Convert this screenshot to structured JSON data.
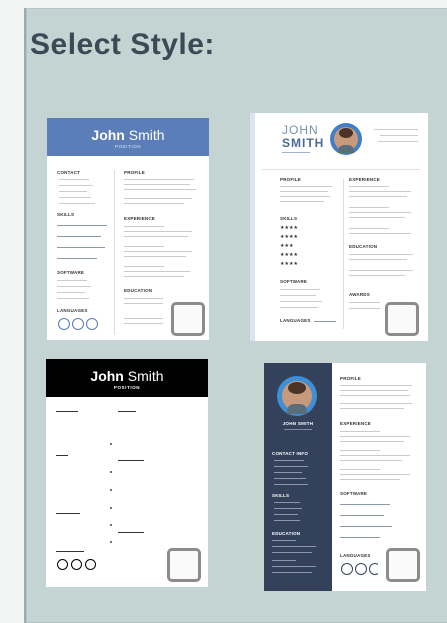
{
  "title": "Select Style:",
  "templates": [
    {
      "first": "John",
      "last": "Smith",
      "position": "POSITION",
      "sections_left": [
        "CONTACT",
        "SKILLS",
        "SOFTWARE",
        "LANGUAGES"
      ],
      "sections_right": [
        "PROFILE",
        "EXPERIENCE",
        "EDUCATION"
      ],
      "header_color": "#5b7db8"
    },
    {
      "first": "JOHN",
      "last": "SMITH",
      "sections_left": [
        "PROFILE",
        "SKILLS",
        "SOFTWARE",
        "LANGUAGES"
      ],
      "sections_right": [
        "EXPERIENCE",
        "EDUCATION",
        "AWARDS"
      ]
    },
    {
      "first": "John",
      "last": "Smith",
      "position": "POSITION",
      "header_color": "#000000"
    },
    {
      "name_line": "JOHN SMITH",
      "sidebar_sections": [
        "CONTACT INFO",
        "SKILLS",
        "EDUCATION"
      ],
      "main_sections": [
        "PROFILE",
        "EXPERIENCE",
        "SOFTWARE",
        "LANGUAGES"
      ],
      "sidebar_color": "#33425a"
    }
  ]
}
